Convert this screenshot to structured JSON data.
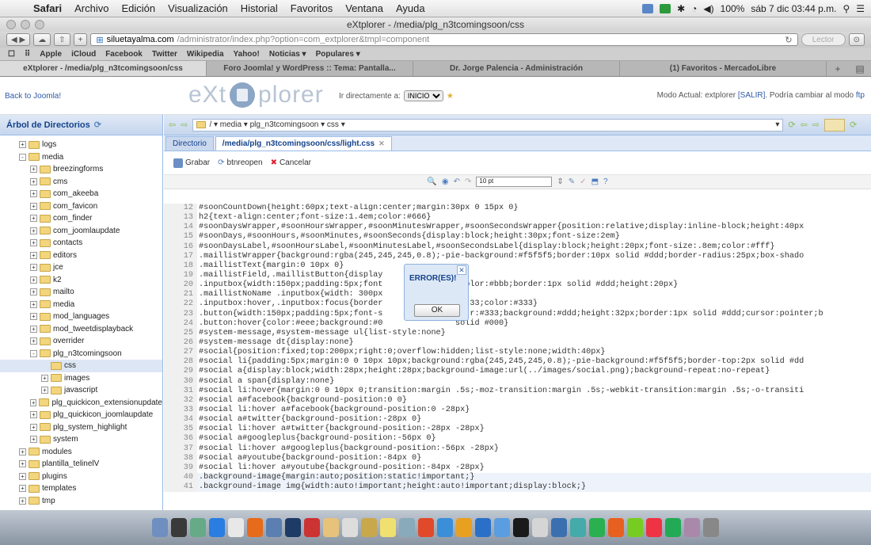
{
  "menubar": {
    "app": "Safari",
    "items": [
      "Archivo",
      "Edición",
      "Visualización",
      "Historial",
      "Favoritos",
      "Ventana",
      "Ayuda"
    ],
    "battery": "100%",
    "clock": "sáb 7 dic  03:44 p.m."
  },
  "window": {
    "title": "eXtplorer - /media/plg_n3tcomingsoon/css"
  },
  "navbar": {
    "url_domain": "siluetayalma.com",
    "url_rest": "/administrator/index.php?option=com_extplorer&tmpl=component",
    "reader": "Lector"
  },
  "bookmarks": [
    "Apple",
    "iCloud",
    "Facebook",
    "Twitter",
    "Wikipedia",
    "Yahoo!",
    "Noticias ▾",
    "Populares ▾"
  ],
  "tabs": [
    "eXtplorer - /media/plg_n3tcomingsoon/css",
    "Foro Joomla! y WordPress :: Tema: Pantalla...",
    "Dr. Jorge Palencia - Administración",
    "(1) Favoritos - MercadoLibre"
  ],
  "header": {
    "back": "Back to Joomla!",
    "logo_left": "eXt",
    "logo_right": "plorer",
    "goto_label": "Ir directamente a:",
    "goto_value": "INICIO",
    "mode_text": "Modo Actual: extplorer",
    "mode_exit": "[SALIR]",
    "mode_tail": ". Podría cambiar al modo",
    "mode_ftp": "ftp"
  },
  "tree": {
    "title": "Árbol de Directorios",
    "items": [
      {
        "label": "logs",
        "depth": 1,
        "pm": "+"
      },
      {
        "label": "media",
        "depth": 1,
        "pm": "-"
      },
      {
        "label": "breezingforms",
        "depth": 2,
        "pm": "+"
      },
      {
        "label": "cms",
        "depth": 2,
        "pm": "+"
      },
      {
        "label": "com_akeeba",
        "depth": 2,
        "pm": "+"
      },
      {
        "label": "com_favicon",
        "depth": 2,
        "pm": "+"
      },
      {
        "label": "com_finder",
        "depth": 2,
        "pm": "+"
      },
      {
        "label": "com_joomlaupdate",
        "depth": 2,
        "pm": "+"
      },
      {
        "label": "contacts",
        "depth": 2,
        "pm": "+"
      },
      {
        "label": "editors",
        "depth": 2,
        "pm": "+"
      },
      {
        "label": "jce",
        "depth": 2,
        "pm": "+"
      },
      {
        "label": "k2",
        "depth": 2,
        "pm": "+"
      },
      {
        "label": "mailto",
        "depth": 2,
        "pm": "+"
      },
      {
        "label": "media",
        "depth": 2,
        "pm": "+"
      },
      {
        "label": "mod_languages",
        "depth": 2,
        "pm": "+"
      },
      {
        "label": "mod_tweetdisplayback",
        "depth": 2,
        "pm": "+"
      },
      {
        "label": "overrider",
        "depth": 2,
        "pm": "+"
      },
      {
        "label": "plg_n3tcomingsoon",
        "depth": 2,
        "pm": "-"
      },
      {
        "label": "css",
        "depth": 3,
        "pm": "",
        "selected": true
      },
      {
        "label": "images",
        "depth": 3,
        "pm": "+"
      },
      {
        "label": "javascript",
        "depth": 3,
        "pm": "+"
      },
      {
        "label": "plg_quickicon_extensionupdate",
        "depth": 2,
        "pm": "+"
      },
      {
        "label": "plg_quickicon_joomlaupdate",
        "depth": 2,
        "pm": "+"
      },
      {
        "label": "plg_system_highlight",
        "depth": 2,
        "pm": "+"
      },
      {
        "label": "system",
        "depth": 2,
        "pm": "+"
      },
      {
        "label": "modules",
        "depth": 1,
        "pm": "+"
      },
      {
        "label": "plantilla_telinelV",
        "depth": 1,
        "pm": "+"
      },
      {
        "label": "plugins",
        "depth": 1,
        "pm": "+"
      },
      {
        "label": "templates",
        "depth": 1,
        "pm": "+"
      },
      {
        "label": "tmp",
        "depth": 1,
        "pm": "+"
      }
    ]
  },
  "main": {
    "path": "/  ▾  media  ▾  plg_n3tcomingsoon  ▾  css ▾",
    "tab_dir": "Directorio",
    "tab_file": "/media/plg_n3tcomingsoon/css/light.css",
    "save": "Grabar",
    "reopen": "btnreopen",
    "cancel": "Cancelar",
    "fontsize": "10 pt"
  },
  "code": [
    {
      "n": "12",
      "t": "#soonCountDown{height:60px;text-align:center;margin:30px 0 15px 0}"
    },
    {
      "n": "13",
      "t": "h2{text-align:center;font-size:1.4em;color:#666}"
    },
    {
      "n": "14",
      "t": "#soonDaysWrapper,#soonHoursWrapper,#soonMinutesWrapper,#soonSecondsWrapper{position:relative;display:inline-block;height:40px"
    },
    {
      "n": "15",
      "t": "#soonDays,#soonHours,#soonMinutes,#soonSeconds{display:block;height:30px;font-size:2em}"
    },
    {
      "n": "16",
      "t": "#soonDaysLabel,#soonHoursLabel,#soonMinutesLabel,#soonSecondsLabel{display:block;height:20px;font-size:.8em;color:#fff}"
    },
    {
      "n": "17",
      "t": ".maillistWrapper{background:rgba(245,245,245,0.8);-pie-background:#f5f5f5;border:10px solid #ddd;border-radius:25px;box-shado"
    },
    {
      "n": "18",
      "t": ".maillistText{margin:0 10px 0}"
    },
    {
      "n": "19",
      "t": ".maillistField,.maillistButton{display"
    },
    {
      "n": "20",
      "t": ".inputbox{width:150px;padding:5px;font                 olor:#bbb;border:1px solid #ddd;height:20px}"
    },
    {
      "n": "21",
      "t": ".maillistNoName .inputbox{width: 300px"
    },
    {
      "n": "22",
      "t": ".inputbox:hover,.inputbox:focus{border                  33;color:#333}"
    },
    {
      "n": "23",
      "t": ".button{width:150px;padding:5px;font-s                  r:#333;background:#ddd;height:32px;border:1px solid #ddd;cursor:pointer;b"
    },
    {
      "n": "24",
      "t": ".button:hover{color:#eee;background:#0               solid #000}"
    },
    {
      "n": "25",
      "t": "#system-message,#system-message ul{list-style:none}"
    },
    {
      "n": "26",
      "t": "#system-message dt{display:none}"
    },
    {
      "n": "27",
      "t": "#social{position:fixed;top:200px;right:0;overflow:hidden;list-style:none;width:40px}"
    },
    {
      "n": "28",
      "t": "#social li{padding:5px;margin:0 0 10px 10px;background:rgba(245,245,245,0.8);-pie-background:#f5f5f5;border-top:2px solid #dd"
    },
    {
      "n": "29",
      "t": "#social a{display:block;width:28px;height:28px;background-image:url(../images/social.png);background-repeat:no-repeat}"
    },
    {
      "n": "30",
      "t": "#social a span{display:none}"
    },
    {
      "n": "31",
      "t": "#social li:hover{margin:0 0 10px 0;transition:margin .5s;-moz-transition:margin .5s;-webkit-transition:margin .5s;-o-transiti"
    },
    {
      "n": "32",
      "t": "#social a#facebook{background-position:0 0}"
    },
    {
      "n": "33",
      "t": "#social li:hover a#facebook{background-position:0 -28px}"
    },
    {
      "n": "34",
      "t": "#social a#twitter{background-position:-28px 0}"
    },
    {
      "n": "35",
      "t": "#social li:hover a#twitter{background-position:-28px -28px}"
    },
    {
      "n": "36",
      "t": "#social a#googleplus{background-position:-56px 0}"
    },
    {
      "n": "37",
      "t": "#social li:hover a#googleplus{background-position:-56px -28px}"
    },
    {
      "n": "38",
      "t": "#social a#youtube{background-position:-84px 0}"
    },
    {
      "n": "39",
      "t": "#social li:hover a#youtube{background-position:-84px -28px}"
    },
    {
      "n": "40",
      "t": ".background-image{margin:auto;position:static!important;}"
    },
    {
      "n": "41",
      "t": ".background-image img{width:auto!important;height:auto!important;display:block;}"
    }
  ],
  "dialog": {
    "title": "ERROR(ES)!",
    "ok": "OK",
    "close": "✕"
  },
  "dock": {
    "colors": [
      "#6e8fbf",
      "#3a3a3a",
      "#6a8",
      "#2a7de1",
      "#e8e8e8",
      "#e66b1a",
      "#5a7fb0",
      "#1e3a66",
      "#c33",
      "#e7c27a",
      "#ddd",
      "#c8a84a",
      "#f0e070",
      "#8ab",
      "#e04a2a",
      "#3a8fd8",
      "#e8a020",
      "#2a70c8",
      "#5a9de0",
      "#1a1a1a",
      "#d5d5d5",
      "#3a70b0",
      "#4aa",
      "#2ab050",
      "#e86020",
      "#7c2",
      "#e34",
      "#2a5",
      "#a8a",
      "#888"
    ]
  }
}
